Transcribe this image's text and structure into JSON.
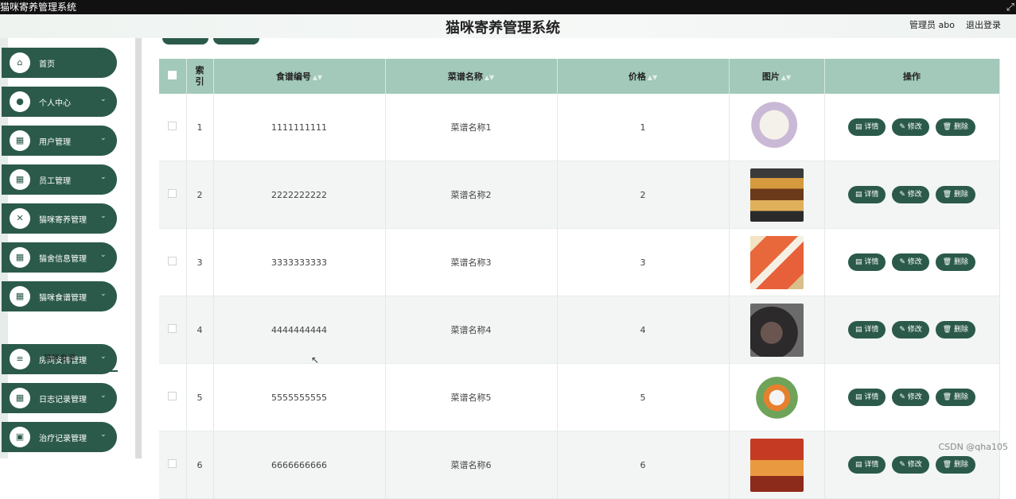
{
  "window": {
    "title": "猫咪寄养管理系统",
    "corner_icon": "resize-icon"
  },
  "header": {
    "title": "猫咪寄养管理系统",
    "user_label": "管理员 abo",
    "logout_label": "退出登录"
  },
  "sidebar": {
    "items": [
      {
        "label": "首页",
        "icon": "home-icon",
        "glyph": "⌂",
        "has_children": false
      },
      {
        "label": "个人中心",
        "icon": "person-icon",
        "glyph": "●",
        "has_children": true
      },
      {
        "label": "用户管理",
        "icon": "grid-icon",
        "glyph": "▦",
        "has_children": true
      },
      {
        "label": "员工管理",
        "icon": "grid-icon",
        "glyph": "▦",
        "has_children": true
      },
      {
        "label": "猫咪寄养管理",
        "icon": "ticket-icon",
        "glyph": "✕",
        "has_children": true
      },
      {
        "label": "猫舍信息管理",
        "icon": "grid-icon",
        "glyph": "▦",
        "has_children": true
      },
      {
        "label": "猫咪食谱管理",
        "icon": "grid-icon",
        "glyph": "▦",
        "has_children": true
      },
      {
        "label": "房间安排管理",
        "icon": "list-icon",
        "glyph": "≡",
        "has_children": true
      },
      {
        "label": "日志记录管理",
        "icon": "grid-icon",
        "glyph": "▦",
        "has_children": true
      },
      {
        "label": "治疗记录管理",
        "icon": "clipboard-icon",
        "glyph": "▣",
        "has_children": true
      }
    ],
    "active_submenu": "猫咪食谱"
  },
  "table": {
    "columns": {
      "index": "索引",
      "code": "食谱编号",
      "name": "菜谱名称",
      "price": "价格",
      "image": "图片",
      "actions": "操作"
    },
    "action_labels": {
      "detail": "详情",
      "edit": "修改",
      "delete": "删除"
    },
    "rows": [
      {
        "index": "1",
        "code": "1111111111",
        "name": "菜谱名称1",
        "price": "1"
      },
      {
        "index": "2",
        "code": "2222222222",
        "name": "菜谱名称2",
        "price": "2"
      },
      {
        "index": "3",
        "code": "3333333333",
        "name": "菜谱名称3",
        "price": "3"
      },
      {
        "index": "4",
        "code": "4444444444",
        "name": "菜谱名称4",
        "price": "4"
      },
      {
        "index": "5",
        "code": "5555555555",
        "name": "菜谱名称5",
        "price": "5"
      },
      {
        "index": "6",
        "code": "6666666666",
        "name": "菜谱名称6",
        "price": "6"
      }
    ]
  },
  "watermark": "CSDN @qha105",
  "colors": {
    "accent": "#2b5a4b",
    "header_row": "#a2c9ba"
  }
}
